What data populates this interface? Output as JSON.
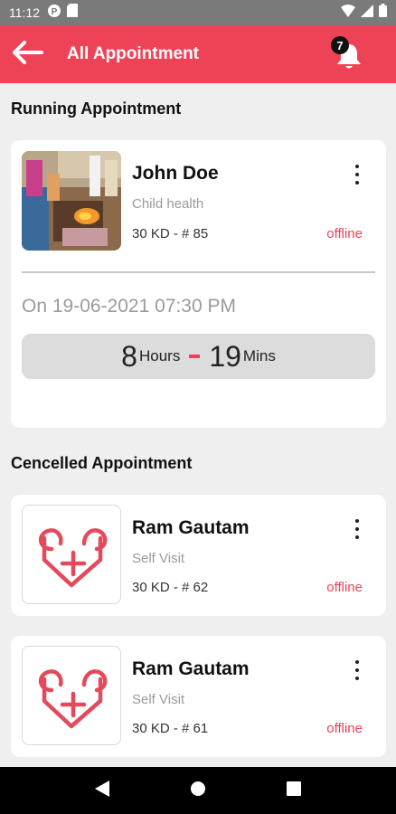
{
  "status_bar": {
    "time": "11:12"
  },
  "app_bar": {
    "title": "All Appointment",
    "notification_count": "7"
  },
  "running": {
    "section_title": "Running Appointment",
    "card": {
      "name": "John Doe",
      "service": "Child health",
      "fee": "30 KD - # 85",
      "status": "offline",
      "date": "On 19-06-2021 07:30 PM",
      "hours_value": "8",
      "hours_label": "Hours",
      "mins_value": "19",
      "mins_label": "Mins"
    }
  },
  "cancelled": {
    "section_title": "Cencelled Appointment",
    "cards": [
      {
        "name": "Ram Gautam",
        "service": "Self Visit",
        "fee": "30 KD - # 62",
        "status": "offline"
      },
      {
        "name": "Ram Gautam",
        "service": "Self Visit",
        "fee": "30 KD - # 61",
        "status": "offline"
      }
    ]
  },
  "colors": {
    "primary": "#ee4357",
    "background": "#efefef",
    "status_bar": "#7a7a7a"
  }
}
